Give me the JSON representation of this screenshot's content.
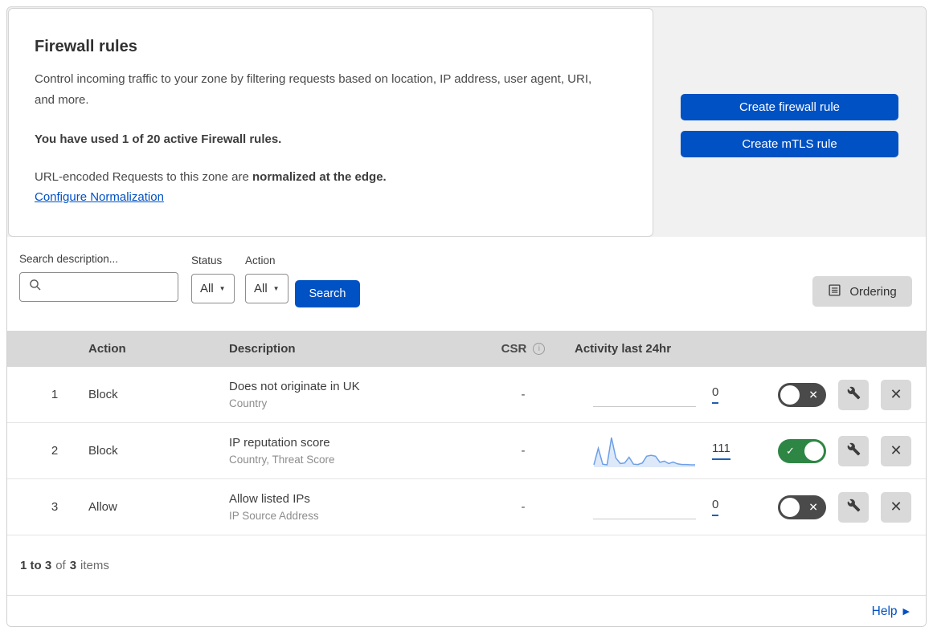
{
  "header": {
    "title": "Firewall rules",
    "description": "Control incoming traffic to your zone by filtering requests based on location, IP address, user agent, URI, and more.",
    "usage": "You have used 1 of 20 active Firewall rules.",
    "normalization_prefix": "URL-encoded Requests to this zone are ",
    "normalization_bold": "normalized at the edge.",
    "normalization_link": "Configure Normalization"
  },
  "actions": {
    "create_firewall_rule": "Create firewall rule",
    "create_mtls_rule": "Create mTLS rule"
  },
  "filters": {
    "search_label": "Search description...",
    "status_label": "Status",
    "status_value": "All",
    "action_label": "Action",
    "action_value": "All",
    "search_button": "Search",
    "ordering_button": "Ordering"
  },
  "table": {
    "headers": {
      "action": "Action",
      "description": "Description",
      "csr": "CSR",
      "activity": "Activity last 24hr"
    },
    "rows": [
      {
        "number": "1",
        "action": "Block",
        "description": "Does not originate in UK",
        "criteria": "Country",
        "csr": "-",
        "count": "0",
        "enabled": false
      },
      {
        "number": "2",
        "action": "Block",
        "description": "IP reputation score",
        "criteria": "Country, Threat Score",
        "csr": "-",
        "count": "111",
        "enabled": true,
        "sparkline": [
          8,
          62,
          10,
          8,
          97,
          30,
          12,
          14,
          33,
          10,
          9,
          14,
          36,
          39,
          36,
          16,
          20,
          12,
          17,
          11,
          9,
          9,
          8,
          8
        ]
      },
      {
        "number": "3",
        "action": "Allow",
        "description": "Allow listed IPs",
        "criteria": "IP Source Address",
        "csr": "-",
        "count": "0",
        "enabled": false
      }
    ]
  },
  "footer": {
    "range": "1 to 3",
    "of_text": "of",
    "total": "3",
    "items_text": "items",
    "help": "Help"
  },
  "icons": {
    "info": "i",
    "close": "✕",
    "check": "✓",
    "dropdown_arrow": "▼",
    "help_arrow": "▶"
  },
  "colors": {
    "accent_blue": "#0051c3",
    "toggle_on_green": "#2e8644",
    "toggle_off_gray": "#4a4a4a",
    "sparkline_line": "#6d9fe8",
    "sparkline_fill": "#dde9f9",
    "table_header_bg": "#d8d8d8",
    "side_panel_bg": "#f1f1f1"
  }
}
